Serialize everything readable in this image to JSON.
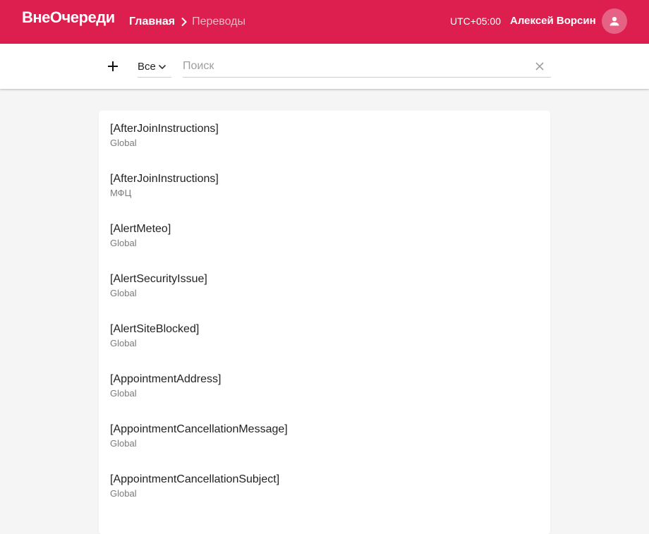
{
  "header": {
    "logo": "ВнеОчереди",
    "breadcrumb": {
      "home": "Главная",
      "current": "Переводы"
    },
    "timezone": "UTC+05:00",
    "user_name": "Алексей Ворсин"
  },
  "toolbar": {
    "filter_value": "Все",
    "search_placeholder": "Поиск",
    "search_value": ""
  },
  "translations": [
    {
      "key": "[AfterJoinInstructions]",
      "scope": "Global"
    },
    {
      "key": "[AfterJoinInstructions]",
      "scope": "МФЦ"
    },
    {
      "key": "[AlertMeteo]",
      "scope": "Global"
    },
    {
      "key": "[AlertSecurityIssue]",
      "scope": "Global"
    },
    {
      "key": "[AlertSiteBlocked]",
      "scope": "Global"
    },
    {
      "key": "[AppointmentAddress]",
      "scope": "Global"
    },
    {
      "key": "[AppointmentCancellationMessage]",
      "scope": "Global"
    },
    {
      "key": "[AppointmentCancellationSubject]",
      "scope": "Global"
    }
  ]
}
